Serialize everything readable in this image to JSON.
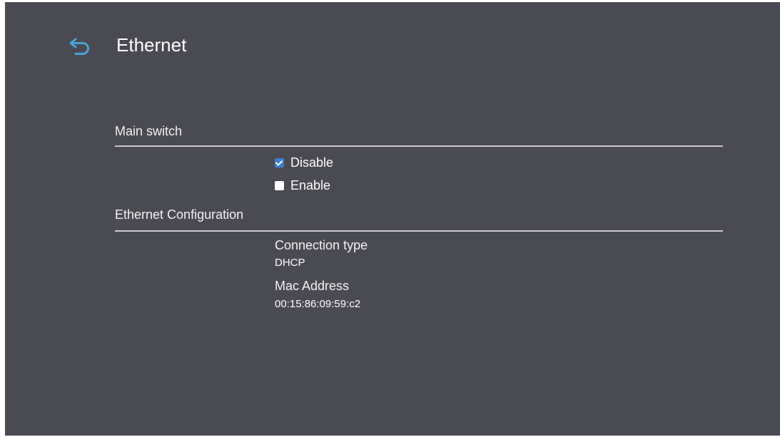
{
  "header": {
    "title": "Ethernet",
    "back_icon": "back-arrow-icon",
    "accent_color": "#4aa3d8"
  },
  "main_switch": {
    "label": "Main switch",
    "options": [
      {
        "label": "Disable",
        "checked": true
      },
      {
        "label": "Enable",
        "checked": false
      }
    ]
  },
  "ethernet_configuration": {
    "label": "Ethernet Configuration",
    "connection_type_label": "Connection type",
    "connection_type_value": "DHCP",
    "mac_address_label": "Mac Address",
    "mac_address_value": "00:15:86:09:59:c2"
  },
  "colors": {
    "background": "#4a4a53",
    "checkbox_checked": "#3a7fd0",
    "divider": "#c9c9cc"
  }
}
